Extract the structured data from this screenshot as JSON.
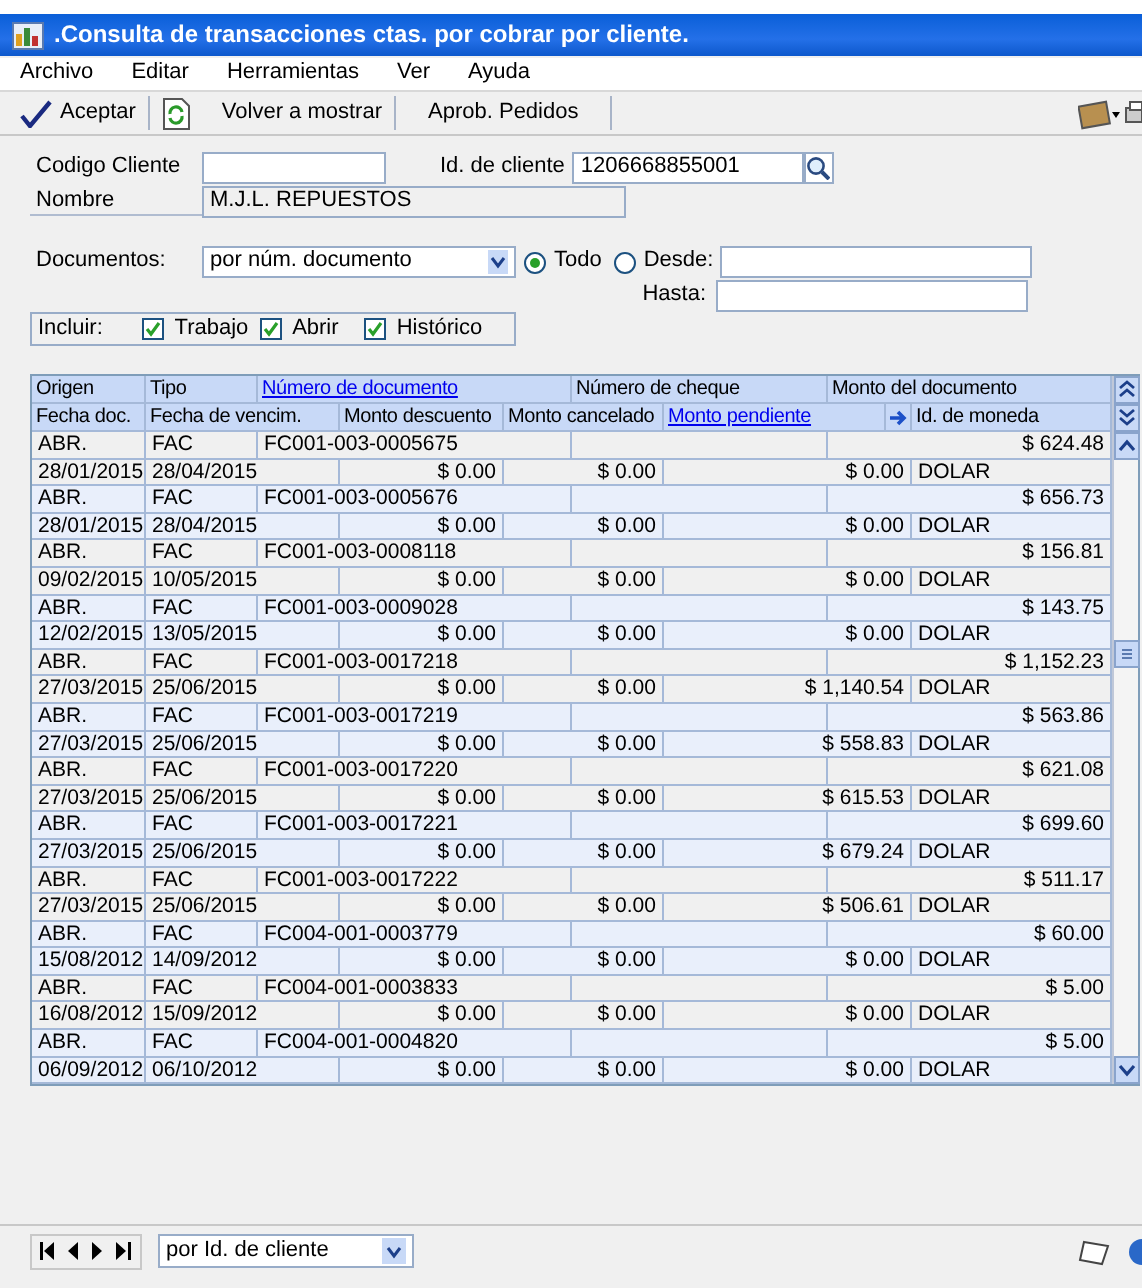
{
  "window": {
    "title": ".Consulta de transacciones ctas. por cobrar por cliente."
  },
  "menu": [
    "Archivo",
    "Editar",
    "Herramientas",
    "Ver",
    "Ayuda"
  ],
  "toolbar": [
    {
      "kind": "check",
      "label": "Aceptar"
    },
    {
      "kind": "refresh",
      "label": "Volver a mostrar"
    },
    {
      "kind": "plain",
      "label": "Aprob. Pedidos"
    }
  ],
  "form": {
    "codigo_cliente": {
      "label": "Codigo Cliente"
    },
    "id_cliente": {
      "label": "Id. de cliente",
      "value": "1206668855001"
    },
    "nombre": {
      "label": "Nombre",
      "value": "M.J.L. REPUESTOS"
    },
    "documentos": {
      "label": "Documentos:",
      "value": "por núm. documento"
    },
    "range": [
      {
        "label": "Todo",
        "selected": true
      },
      {
        "label": "Desde:",
        "selected": false
      }
    ],
    "hasta": {
      "label": "Hasta:"
    },
    "incluir": {
      "label": "Incluir:",
      "options": [
        {
          "label": "Trabajo",
          "checked": true
        },
        {
          "label": "Abrir",
          "checked": true
        },
        {
          "label": "Histórico",
          "checked": true
        }
      ]
    }
  },
  "grid": {
    "columns_line1": [
      {
        "label": "Origen",
        "sorted": false
      },
      {
        "label": "Tipo",
        "sorted": false
      },
      {
        "label": "Número de documento",
        "sorted": true
      },
      {
        "label": "Número de cheque",
        "sorted": false
      },
      {
        "label": "Monto del documento",
        "sorted": false
      }
    ],
    "columns_line2": [
      {
        "label": "Fecha doc.",
        "sorted": false
      },
      {
        "label": "Fecha de vencim.",
        "sorted": false
      },
      {
        "label": "Monto descuento",
        "sorted": false
      },
      {
        "label": "Monto cancelado",
        "sorted": false
      },
      {
        "label": "Monto pendiente",
        "sorted": true
      },
      {
        "label": "Id. de moneda",
        "sorted": false
      }
    ],
    "rows": [
      {
        "origen": "ABR.",
        "tipo": "FAC",
        "numero": "FC001-003-0005675",
        "monto_documento": "$ 624.48",
        "fecha_doc": "28/01/2015",
        "fecha_venc": "28/04/2015",
        "monto_descuento": "$ 0.00",
        "monto_cancelado": "$ 0.00",
        "monto_pendiente": "$ 0.00",
        "moneda": "DOLAR"
      },
      {
        "origen": "ABR.",
        "tipo": "FAC",
        "numero": "FC001-003-0005676",
        "monto_documento": "$ 656.73",
        "fecha_doc": "28/01/2015",
        "fecha_venc": "28/04/2015",
        "monto_descuento": "$ 0.00",
        "monto_cancelado": "$ 0.00",
        "monto_pendiente": "$ 0.00",
        "moneda": "DOLAR"
      },
      {
        "origen": "ABR.",
        "tipo": "FAC",
        "numero": "FC001-003-0008118",
        "monto_documento": "$ 156.81",
        "fecha_doc": "09/02/2015",
        "fecha_venc": "10/05/2015",
        "monto_descuento": "$ 0.00",
        "monto_cancelado": "$ 0.00",
        "monto_pendiente": "$ 0.00",
        "moneda": "DOLAR"
      },
      {
        "origen": "ABR.",
        "tipo": "FAC",
        "numero": "FC001-003-0009028",
        "monto_documento": "$ 143.75",
        "fecha_doc": "12/02/2015",
        "fecha_venc": "13/05/2015",
        "monto_descuento": "$ 0.00",
        "monto_cancelado": "$ 0.00",
        "monto_pendiente": "$ 0.00",
        "moneda": "DOLAR"
      },
      {
        "origen": "ABR.",
        "tipo": "FAC",
        "numero": "FC001-003-0017218",
        "monto_documento": "$ 1,152.23",
        "fecha_doc": "27/03/2015",
        "fecha_venc": "25/06/2015",
        "monto_descuento": "$ 0.00",
        "monto_cancelado": "$ 0.00",
        "monto_pendiente": "$ 1,140.54",
        "moneda": "DOLAR"
      },
      {
        "origen": "ABR.",
        "tipo": "FAC",
        "numero": "FC001-003-0017219",
        "monto_documento": "$ 563.86",
        "fecha_doc": "27/03/2015",
        "fecha_venc": "25/06/2015",
        "monto_descuento": "$ 0.00",
        "monto_cancelado": "$ 0.00",
        "monto_pendiente": "$ 558.83",
        "moneda": "DOLAR"
      },
      {
        "origen": "ABR.",
        "tipo": "FAC",
        "numero": "FC001-003-0017220",
        "monto_documento": "$ 621.08",
        "fecha_doc": "27/03/2015",
        "fecha_venc": "25/06/2015",
        "monto_descuento": "$ 0.00",
        "monto_cancelado": "$ 0.00",
        "monto_pendiente": "$ 615.53",
        "moneda": "DOLAR"
      },
      {
        "origen": "ABR.",
        "tipo": "FAC",
        "numero": "FC001-003-0017221",
        "monto_documento": "$ 699.60",
        "fecha_doc": "27/03/2015",
        "fecha_venc": "25/06/2015",
        "monto_descuento": "$ 0.00",
        "monto_cancelado": "$ 0.00",
        "monto_pendiente": "$ 679.24",
        "moneda": "DOLAR"
      },
      {
        "origen": "ABR.",
        "tipo": "FAC",
        "numero": "FC001-003-0017222",
        "monto_documento": "$ 511.17",
        "fecha_doc": "27/03/2015",
        "fecha_venc": "25/06/2015",
        "monto_descuento": "$ 0.00",
        "monto_cancelado": "$ 0.00",
        "monto_pendiente": "$ 506.61",
        "moneda": "DOLAR"
      },
      {
        "origen": "ABR.",
        "tipo": "FAC",
        "numero": "FC004-001-0003779",
        "monto_documento": "$ 60.00",
        "fecha_doc": "15/08/2012",
        "fecha_venc": "14/09/2012",
        "monto_descuento": "$ 0.00",
        "monto_cancelado": "$ 0.00",
        "monto_pendiente": "$ 0.00",
        "moneda": "DOLAR"
      },
      {
        "origen": "ABR.",
        "tipo": "FAC",
        "numero": "FC004-001-0003833",
        "monto_documento": "$ 5.00",
        "fecha_doc": "16/08/2012",
        "fecha_venc": "15/09/2012",
        "monto_descuento": "$ 0.00",
        "monto_cancelado": "$ 0.00",
        "monto_pendiente": "$ 0.00",
        "moneda": "DOLAR"
      },
      {
        "origen": "ABR.",
        "tipo": "FAC",
        "numero": "FC004-001-0004820",
        "monto_documento": "$ 5.00",
        "fecha_doc": "06/09/2012",
        "fecha_venc": "06/10/2012",
        "monto_descuento": "$ 0.00",
        "monto_cancelado": "$ 0.00",
        "monto_pendiente": "$ 0.00",
        "moneda": "DOLAR"
      }
    ]
  },
  "footer": {
    "sort": "por Id. de cliente"
  }
}
